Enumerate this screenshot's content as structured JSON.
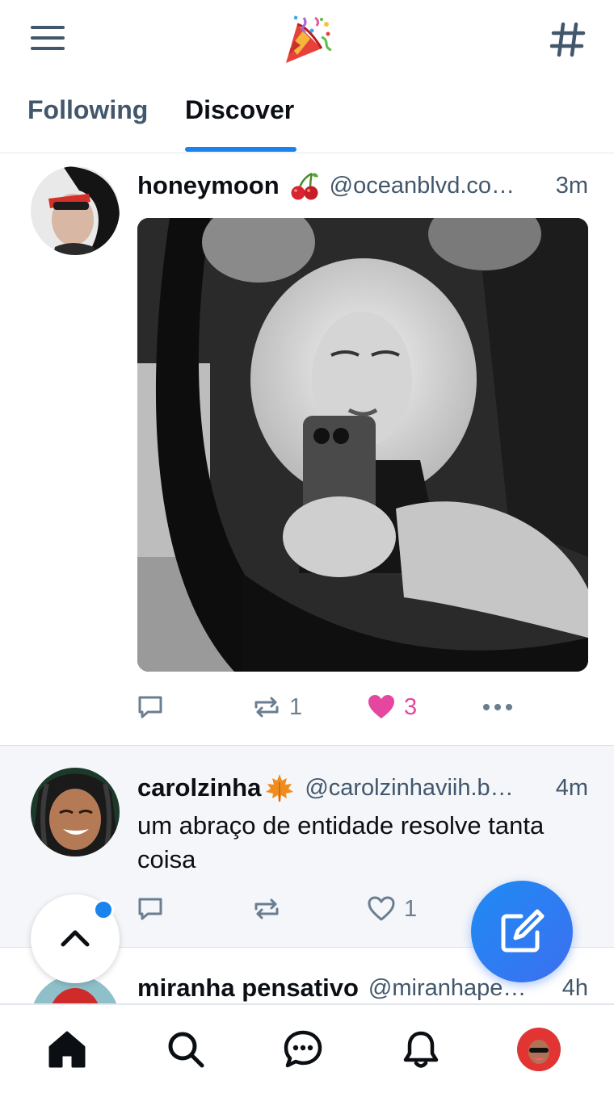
{
  "header": {
    "menu_icon": "hamburger-menu-icon",
    "logo_icon": "party-popper-icon",
    "feeds_icon": "hashtag-icon"
  },
  "tabs": [
    {
      "label": "Following",
      "active": false
    },
    {
      "label": "Discover",
      "active": true
    }
  ],
  "colors": {
    "accent": "#1a83ed",
    "like": "#e5479f",
    "muted": "#42576c"
  },
  "posts": [
    {
      "display_name": "honeymoon",
      "emoji": "cherries",
      "handle": "@oceanblvd.co…",
      "time": "3m",
      "has_image": true,
      "reply_count": "",
      "repost_count": "1",
      "like_count": "3",
      "liked": true
    },
    {
      "display_name": "carolzinha",
      "emoji": "maple-leaf",
      "handle": "@carolzinhaviih.b…",
      "time": "4m",
      "text": "um abraço de entidade resolve tanta coisa",
      "reply_count": "",
      "repost_count": "",
      "like_count": "1",
      "liked": false
    },
    {
      "display_name": "miranha pensativo",
      "handle": "@miranhape…",
      "time": "4h"
    }
  ],
  "nav": [
    "home",
    "search",
    "chat",
    "notifications",
    "profile"
  ]
}
